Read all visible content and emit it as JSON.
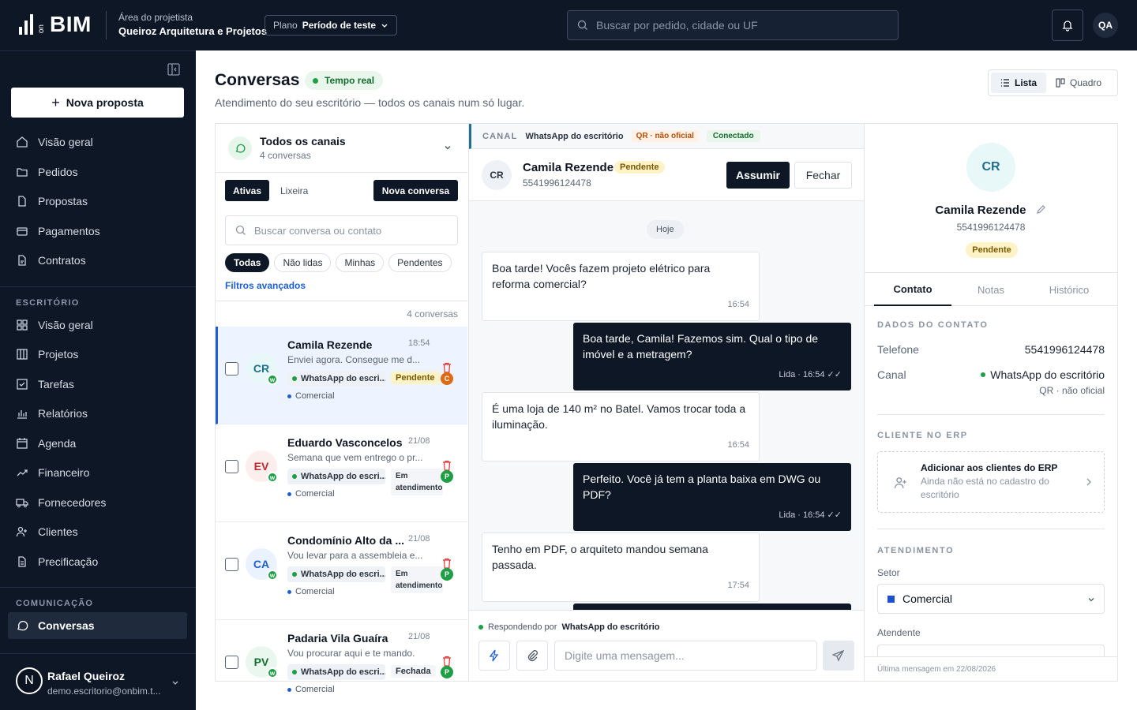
{
  "brand": {
    "logo_prefix": "on",
    "logo_text": "BIM"
  },
  "topbar": {
    "area_label": "Área do projetista",
    "area_name": "Queiroz Arquitetura e Projetos",
    "plan_label": "Plano",
    "plan_value": "Período de teste",
    "search_placeholder": "Buscar por pedido, cidade ou UF",
    "user_initials": "QA"
  },
  "sidebar": {
    "new_proposal": "Nova proposta",
    "main_items": [
      {
        "label": "Visão geral",
        "icon": "home-icon"
      },
      {
        "label": "Pedidos",
        "icon": "folder-icon"
      },
      {
        "label": "Propostas",
        "icon": "file-icon"
      },
      {
        "label": "Pagamentos",
        "icon": "card-icon"
      },
      {
        "label": "Contratos",
        "icon": "contract-icon"
      }
    ],
    "office_label": "ESCRITÓRIO",
    "office_items": [
      {
        "label": "Visão geral",
        "icon": "grid-icon"
      },
      {
        "label": "Projetos",
        "icon": "columns-icon"
      },
      {
        "label": "Tarefas",
        "icon": "checkbox-icon"
      },
      {
        "label": "Relatórios",
        "icon": "bar-chart-icon"
      },
      {
        "label": "Agenda",
        "icon": "calendar-icon"
      },
      {
        "label": "Financeiro",
        "icon": "trend-icon"
      },
      {
        "label": "Fornecedores",
        "icon": "truck-icon"
      },
      {
        "label": "Clientes",
        "icon": "user-plus-icon"
      },
      {
        "label": "Precificação",
        "icon": "price-icon"
      }
    ],
    "comm_label": "COMUNICAÇÃO",
    "comm_items": [
      {
        "label": "Conversas",
        "icon": "chat-icon",
        "active": true
      }
    ],
    "user": {
      "initial": "N",
      "name": "Rafael Queiroz",
      "email": "demo.escritorio@onbim.t..."
    }
  },
  "page": {
    "title": "Conversas",
    "realtime": "Tempo real",
    "subtitle": "Atendimento do seu escritório — todos os canais num só lugar.",
    "view_list": "Lista",
    "view_board": "Quadro"
  },
  "inbox": {
    "channel_title": "Todos os canais",
    "channel_count": "4 conversas",
    "tab_active": "Ativas",
    "tab_trash": "Lixeira",
    "new_conversation": "Nova conversa",
    "search_placeholder": "Buscar conversa ou contato",
    "filters": [
      "Todas",
      "Não lidas",
      "Minhas",
      "Pendentes"
    ],
    "advanced_filters": "Filtros avançados",
    "count_label": "4 conversas",
    "conversations": [
      {
        "initials": "CR",
        "name": "Camila Rezende",
        "time": "18:54",
        "preview": "Enviei agora. Consegue me d...",
        "channel": "WhatsApp do escri...",
        "status": "Pendente",
        "sector": "Comercial",
        "selected": true,
        "avatar_bg": "#e8f7f7",
        "avatar_fg": "#1f6f8f",
        "badge": "C",
        "badge_color": "#e06a10"
      },
      {
        "initials": "EV",
        "name": "Eduardo Vasconcelos",
        "time": "21/08",
        "preview": "Semana que vem entrego o pr...",
        "channel": "WhatsApp do escri...",
        "status": "Em atendimento",
        "sector": "Comercial",
        "selected": false,
        "avatar_bg": "#fdeeee",
        "avatar_fg": "#c0292b",
        "badge": "P",
        "badge_color": "#1e9e45"
      },
      {
        "initials": "CA",
        "name": "Condomínio Alto da ...",
        "time": "21/08",
        "preview": "Vou levar para a assembleia e...",
        "channel": "WhatsApp do escri...",
        "status": "Em atendimento",
        "sector": "Comercial",
        "selected": false,
        "avatar_bg": "#eaf2fd",
        "avatar_fg": "#1d5fd1",
        "badge": "P",
        "badge_color": "#1e9e45"
      },
      {
        "initials": "PV",
        "name": "Padaria Vila Guaíra",
        "time": "21/08",
        "preview": "Vou procurar aqui e te mando.",
        "channel": "WhatsApp do escri...",
        "status": "Fechada",
        "sector": "Comercial",
        "selected": false,
        "avatar_bg": "#eaf7ee",
        "avatar_fg": "#146c2e",
        "badge": "P",
        "badge_color": "#1e9e45"
      }
    ]
  },
  "chat": {
    "canal_label": "CANAL",
    "canal_name": "WhatsApp do escritório",
    "canal_qr": "QR · não oficial",
    "canal_status": "Conectado",
    "contact_initials": "CR",
    "contact_name": "Camila Rezende",
    "contact_status": "Pendente",
    "contact_phone": "5541996124478",
    "assume": "Assumir",
    "close": "Fechar",
    "day": "Hoje",
    "messages": [
      {
        "dir": "in",
        "text": "Boa tarde! Vocês fazem projeto elétrico para reforma comercial?",
        "meta": "16:54"
      },
      {
        "dir": "out",
        "text": "Boa tarde, Camila! Fazemos sim. Qual o tipo de imóvel e a metragem?",
        "meta": "Lida · 16:54 ✓✓"
      },
      {
        "dir": "in",
        "text": "É uma loja de 140 m² no Batel. Vamos trocar toda a iluminação.",
        "meta": "16:54"
      },
      {
        "dir": "out",
        "text": "Perfeito. Você já tem a planta baixa em DWG ou PDF?",
        "meta": "Lida · 16:54 ✓✓"
      },
      {
        "dir": "in",
        "text": "Tenho em PDF, o arquiteto mandou semana passada.",
        "meta": "17:54"
      }
    ],
    "replying_prefix": "Respondendo por",
    "replying_channel": "WhatsApp do escritório",
    "input_placeholder": "Digite uma mensagem..."
  },
  "contact": {
    "initials": "CR",
    "name": "Camila Rezende",
    "phone": "5541996124478",
    "status": "Pendente",
    "tabs": [
      "Contato",
      "Notas",
      "Histórico"
    ],
    "data_label": "DADOS DO CONTATO",
    "phone_label": "Telefone",
    "phone_value": "5541996124478",
    "channel_label": "Canal",
    "channel_value": "WhatsApp do escritório",
    "channel_sub": "QR · não oficial",
    "erp_label": "CLIENTE NO ERP",
    "erp_title": "Adicionar aos clientes do ERP",
    "erp_sub": "Ainda não está no cadastro do escritório",
    "service_label": "ATENDIMENTO",
    "sector_label": "Setor",
    "sector_value": "Comercial",
    "agent_label": "Atendente",
    "footer": "Última mensagem em 22/08/2026"
  },
  "colors": {
    "navy": "#0e1726",
    "accent_blue": "#1d5fd1",
    "green": "#1e9e45",
    "pending_bg": "#fdf3c7"
  }
}
